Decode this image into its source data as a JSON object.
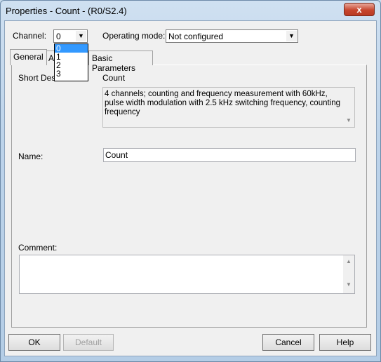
{
  "window": {
    "title": "Properties - Count - (R0/S2.4)",
    "close_label": "x"
  },
  "channel": {
    "label": "Channel:",
    "value": "0",
    "options": [
      "0",
      "1",
      "2",
      "3"
    ],
    "selected_option": "0"
  },
  "operating_mode": {
    "label": "Operating mode:",
    "value": "Not configured"
  },
  "tabs": [
    {
      "label": "General",
      "active": true
    },
    {
      "label": "A"
    },
    {
      "label": "Basic Parameters"
    }
  ],
  "general": {
    "short_desc_label": "Short Desc",
    "short_desc_value": "Count",
    "description": "4 channels; counting and frequency measurement with 60kHz, pulse width modulation with 2.5 kHz switching frequency, counting frequency",
    "name_label": "Name:",
    "name_value": "Count",
    "comment_label": "Comment:",
    "comment_value": ""
  },
  "buttons": {
    "ok": "OK",
    "default": "Default",
    "cancel": "Cancel",
    "help": "Help"
  }
}
